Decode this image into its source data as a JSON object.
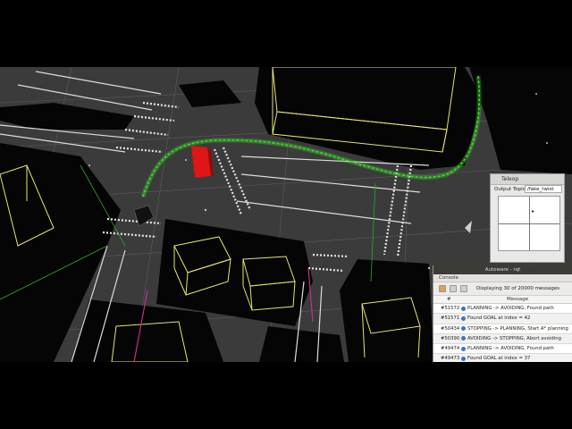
{
  "teleop": {
    "title": "Teleop",
    "output_topic_label": "Output Topic:",
    "output_topic_value": "/fake_twist",
    "cursor_icon": "pointer-cursor-icon"
  },
  "autoware": {
    "window_title": "Autoware - rqt",
    "console_title": "Console",
    "display_text": "Displaying 30 of 20000 messages",
    "col_number": "#",
    "col_message": "Message",
    "rows": [
      {
        "n": "#51572",
        "msg": "PLANNING -> AVOIDING, Found path"
      },
      {
        "n": "#51571",
        "msg": "Found GOAL at index = 42"
      },
      {
        "n": "#50434",
        "msg": "STOPPING -> PLANNING, Start A* planning"
      },
      {
        "n": "#50390",
        "msg": "AVOIDING -> STOPPING, Abort avoiding"
      },
      {
        "n": "#49474",
        "msg": "PLANNING -> AVOIDING, Found path"
      },
      {
        "n": "#49473",
        "msg": "Found GOAL at index = 37"
      }
    ]
  },
  "colors": {
    "path": "#3ddc2a",
    "vehicle": "#e01515",
    "buildings": "#e6e66a",
    "lanes": "#dcdcdc",
    "info_icon": "#3b74c4"
  }
}
